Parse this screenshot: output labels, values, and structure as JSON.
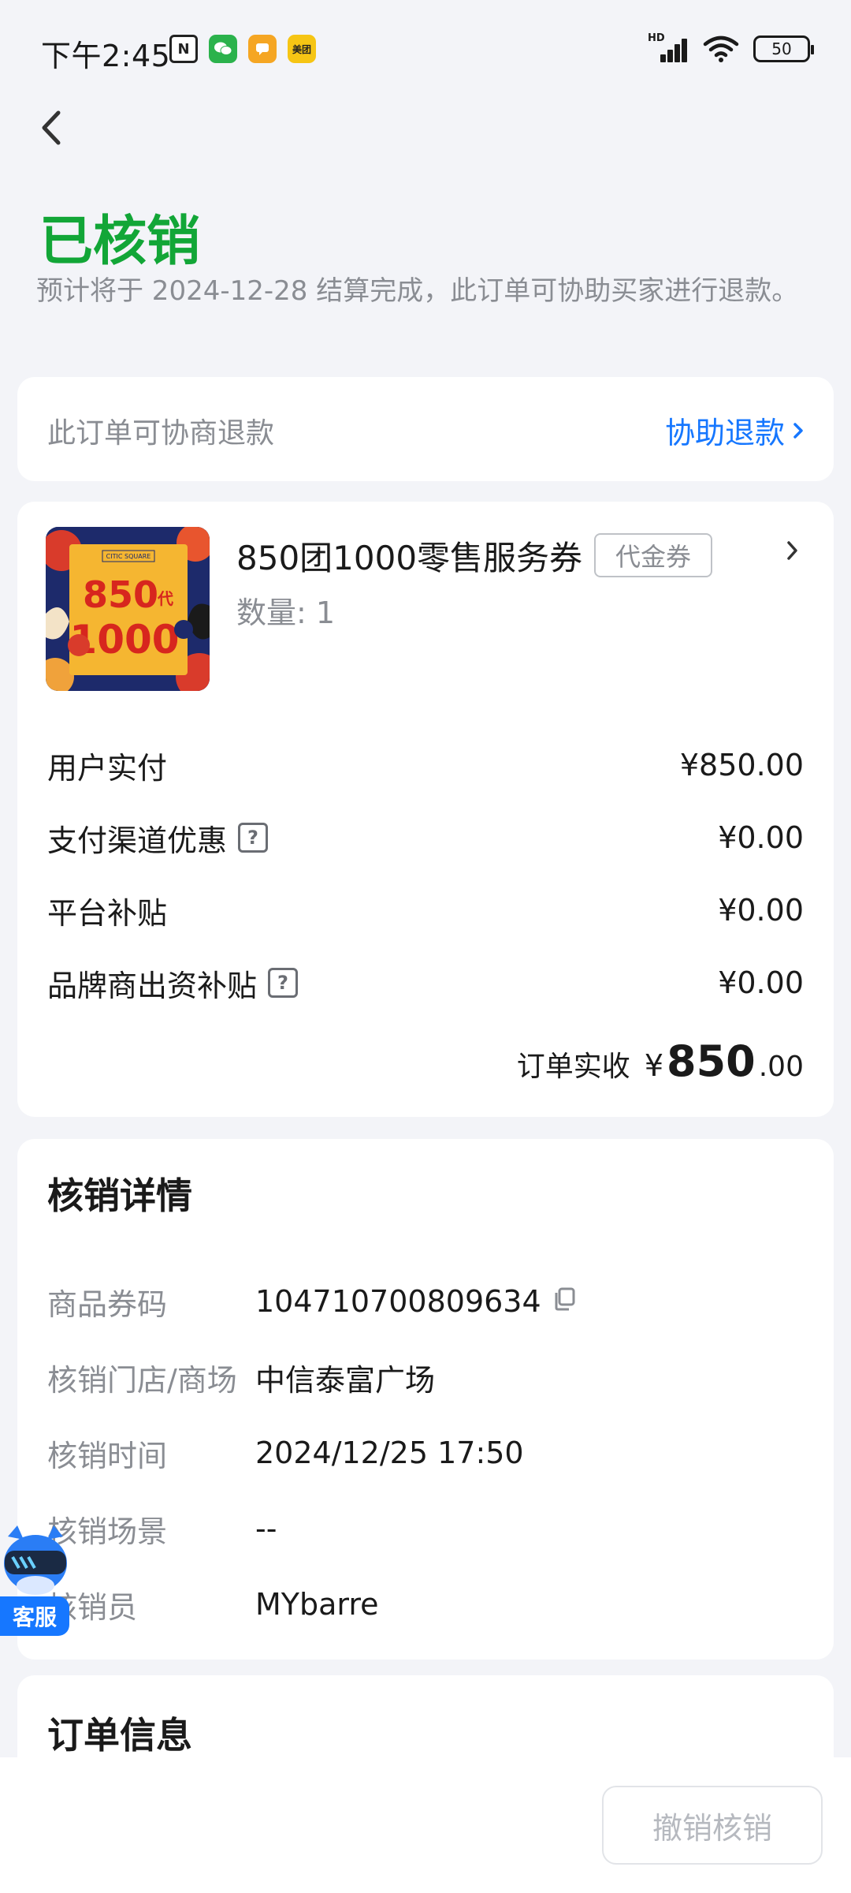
{
  "status_bar": {
    "time": "下午2:45",
    "battery": "50",
    "signal_label": "HD"
  },
  "header": {
    "status_title": "已核销",
    "status_desc": "预计将于 2024-12-28 结算完成，此订单可协助买家进行退款。"
  },
  "refund": {
    "text": "此订单可协商退款",
    "link_label": "协助退款"
  },
  "goods": {
    "name": "850团1000零售服务券",
    "tag": "代金券",
    "quantity": "数量: 1",
    "image": {
      "brand": "CITIC SQUARE",
      "line1": "850",
      "line1_suffix": "代",
      "line2": "1000"
    }
  },
  "prices": {
    "rows": [
      {
        "label": "用户实付",
        "value": "¥850.00",
        "help": false
      },
      {
        "label": "支付渠道优惠",
        "value": "¥0.00",
        "help": true
      },
      {
        "label": "平台补贴",
        "value": "¥0.00",
        "help": false
      },
      {
        "label": "品牌商出资补贴",
        "value": "¥0.00",
        "help": true
      }
    ],
    "order_received_label": "订单实收",
    "order_received_symbol": "¥",
    "order_received_int": "850",
    "order_received_dec": ".00"
  },
  "verification": {
    "title": "核销详情",
    "rows": [
      {
        "label": "商品券码",
        "value": "104710700809634"
      },
      {
        "label": "核销门店/商场",
        "value": "中信泰富广场"
      },
      {
        "label": "核销时间",
        "value": "2024/12/25 17:50"
      },
      {
        "label": "核销场景",
        "value": "--"
      },
      {
        "label": "核销员",
        "value": "MYbarre"
      }
    ]
  },
  "order_info": {
    "title": "订单信息"
  },
  "customer_service": {
    "label": "客服"
  },
  "bottom": {
    "revoke_label": "撤销核销"
  },
  "colors": {
    "status_green": "#12a637",
    "link_blue": "#1677ff",
    "muted_text": "#8a8d93",
    "page_bg": "#f3f4f8"
  }
}
